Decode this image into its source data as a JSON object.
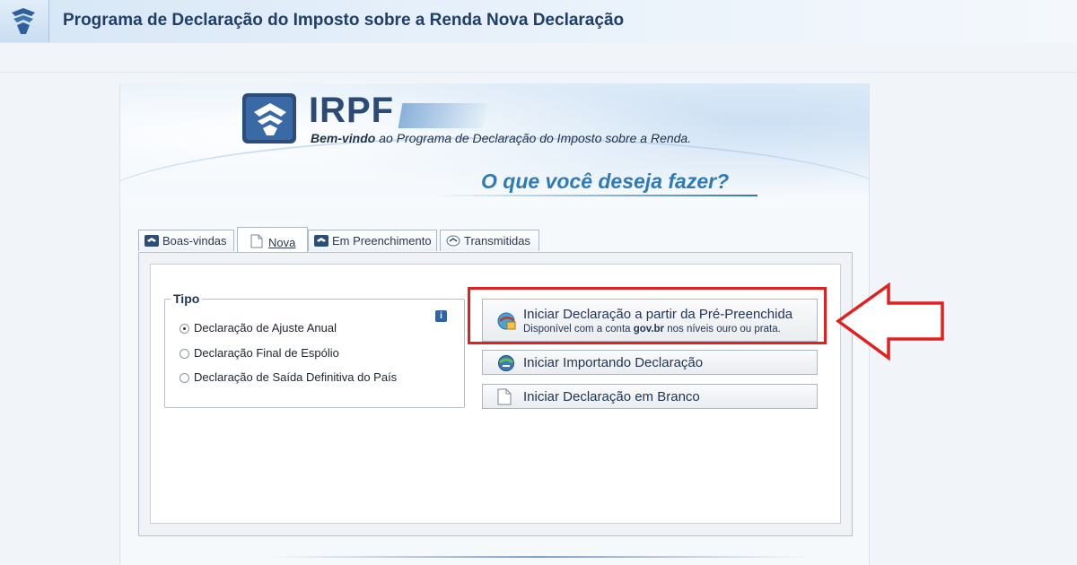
{
  "header": {
    "title": "Programa de Declaração do Imposto sobre a Renda Nova Declaração"
  },
  "hero": {
    "brand": "IRPF",
    "welcome_bold": "Bem-vindo",
    "welcome_rest": " ao Programa de Declaração do Imposto sobre a Renda.",
    "question": "O que você deseja fazer?"
  },
  "tabs": [
    {
      "label": "Boas-vindas",
      "icon": "irpf-icon",
      "active": false
    },
    {
      "label": "Nova",
      "icon": "document-icon",
      "active": true
    },
    {
      "label": "Em Preenchimento",
      "icon": "irpf-icon",
      "active": false
    },
    {
      "label": "Transmitidas",
      "icon": "transmit-icon",
      "active": false
    }
  ],
  "tipo": {
    "legend": "Tipo",
    "options": [
      {
        "label": "Declaração de Ajuste Anual",
        "selected": true
      },
      {
        "label": "Declaração Final de Espólio",
        "selected": false
      },
      {
        "label": "Declaração de Saída Definitiva do País",
        "selected": false
      }
    ],
    "info_label": "i"
  },
  "actions": {
    "prefill": {
      "title": "Iniciar Declaração a partir da Pré-Preenchida",
      "sub_pre": "Disponível com a conta ",
      "sub_bold": "gov.br",
      "sub_post": " nos níveis ouro ou prata."
    },
    "import": {
      "title": "Iniciar Importando Declaração"
    },
    "blank": {
      "title": "Iniciar Declaração em Branco"
    }
  },
  "colors": {
    "highlight": "#e32020",
    "accent": "#2e7ab6",
    "title": "#1f3f6a"
  }
}
